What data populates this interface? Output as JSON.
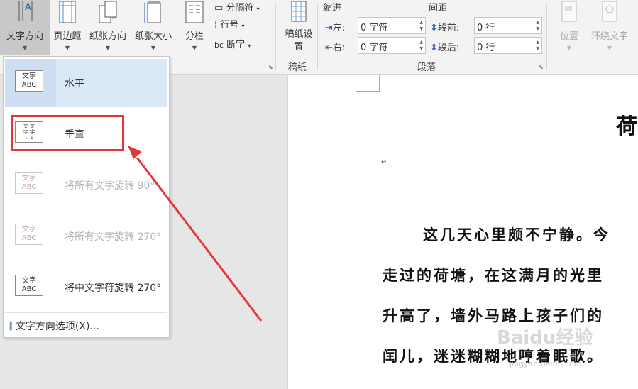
{
  "ribbon": {
    "text_direction": "文字方向",
    "margins": "页边距",
    "orientation": "纸张方向",
    "size": "纸张大小",
    "columns": "分栏",
    "breaks": "分隔符",
    "line_numbers": "行号",
    "hyphenation": "断字",
    "manuscript": "稿纸设置",
    "manuscript_group": "稿纸",
    "indent_header": "缩进",
    "spacing_header": "间距",
    "indent_left_label": "左:",
    "indent_left_value": "0 字符",
    "indent_right_label": "右:",
    "indent_right_value": "0 字符",
    "space_before_label": "段前:",
    "space_before_value": "0 行",
    "space_after_label": "段后:",
    "space_after_value": "0 行",
    "paragraph_group": "段落",
    "position": "位置",
    "wrap_text": "环绕文字"
  },
  "menu": {
    "items": [
      {
        "label": "水平",
        "thumb": "文字 ABC"
      },
      {
        "label": "垂直",
        "thumb": "文字"
      },
      {
        "label": "将所有文字旋转 90°",
        "thumb": "文字 ABC"
      },
      {
        "label": "将所有文字旋转 270°",
        "thumb": "文字 ABC"
      },
      {
        "label": "将中文字符旋转 270°",
        "thumb": "文字 ABC"
      }
    ],
    "options": "文字方向选项(X)..."
  },
  "document": {
    "title_char": "荷",
    "lines": [
      "这几天心里颇不宁静。今",
      "走过的荷塘，在这满月的光里",
      "升高了，墙外马路上孩子们的",
      "闰儿，迷迷糊糊地哼着眠歌。"
    ]
  },
  "watermark": {
    "brand": "Baidu经验",
    "url": "jingyan.baidu.com"
  }
}
